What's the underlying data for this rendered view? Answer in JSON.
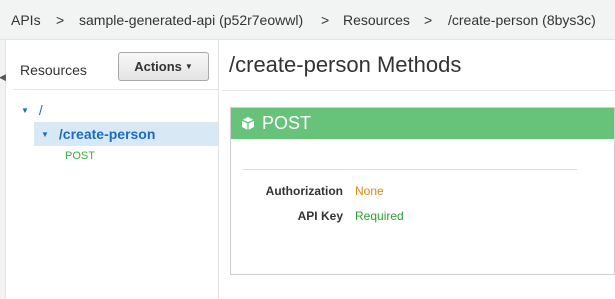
{
  "breadcrumb": {
    "items": [
      "APIs",
      ">",
      "sample-generated-api (p52r7eowwl)",
      ">",
      "Resources",
      ">",
      "/create-person (8bys3c)"
    ]
  },
  "sidebar": {
    "title": "Resources",
    "actions_label": "Actions",
    "tree": {
      "root": "/",
      "child": "/create-person",
      "method": "POST"
    }
  },
  "main": {
    "title": "/create-person Methods",
    "method_card": {
      "method": "POST",
      "header_color": "#67c27a",
      "rows": [
        {
          "label": "Authorization",
          "value": "None",
          "color": "#dc8a0f"
        },
        {
          "label": "API Key",
          "value": "Required",
          "color": "#2f9e33"
        }
      ]
    }
  },
  "colors": {
    "link": "#1a6ebd",
    "selected_bg": "#d8e8f5"
  }
}
